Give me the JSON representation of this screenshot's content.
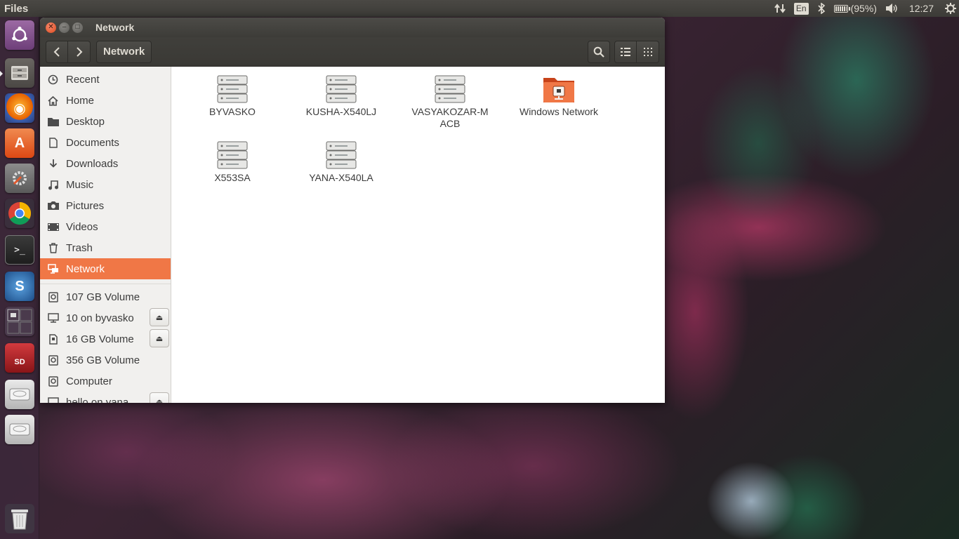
{
  "top_panel": {
    "app_title": "Files",
    "keyboard_layout": "En",
    "battery_percent": "(95%)",
    "battery_level": 0.95,
    "clock": "12:27"
  },
  "launcher": {
    "items": [
      {
        "name": "ubuntu-dash",
        "color": "#7a4b85"
      },
      {
        "name": "files",
        "color": "#5e5a57"
      },
      {
        "name": "firefox",
        "color": "#e66000"
      },
      {
        "name": "software-center",
        "color": "#e0582d"
      },
      {
        "name": "system-settings",
        "color": "#9a9a9a"
      },
      {
        "name": "chrome",
        "color": "#4285f4"
      },
      {
        "name": "terminal",
        "color": "#2d2d2d"
      },
      {
        "name": "app-blue",
        "color": "#2a6fb3"
      },
      {
        "name": "workspace-switcher",
        "color": "#5a4a5e"
      },
      {
        "name": "sd-card",
        "color": "#b3262a"
      },
      {
        "name": "drive-1",
        "color": "#cfcfcf"
      },
      {
        "name": "drive-2",
        "color": "#cfcfcf"
      },
      {
        "name": "trash",
        "color": "#d5d5d5"
      }
    ]
  },
  "window": {
    "title": "Network",
    "path": "Network",
    "sidebar": {
      "places": [
        {
          "label": "Recent",
          "icon": "clock-icon"
        },
        {
          "label": "Home",
          "icon": "home-icon"
        },
        {
          "label": "Desktop",
          "icon": "folder-icon"
        },
        {
          "label": "Documents",
          "icon": "document-icon"
        },
        {
          "label": "Downloads",
          "icon": "download-icon"
        },
        {
          "label": "Music",
          "icon": "music-icon"
        },
        {
          "label": "Pictures",
          "icon": "camera-icon"
        },
        {
          "label": "Videos",
          "icon": "video-icon"
        },
        {
          "label": "Trash",
          "icon": "trash-icon"
        },
        {
          "label": "Network",
          "icon": "network-icon",
          "active": true
        }
      ],
      "devices": [
        {
          "label": "107 GB Volume",
          "icon": "drive-icon",
          "eject": false
        },
        {
          "label": "10 on byvasko",
          "icon": "network-share-icon",
          "eject": true
        },
        {
          "label": "16 GB Volume",
          "icon": "sd-icon",
          "eject": true
        },
        {
          "label": "356 GB Volume",
          "icon": "drive-icon",
          "eject": false
        },
        {
          "label": "Computer",
          "icon": "drive-icon",
          "eject": false
        },
        {
          "label": "hello on yana",
          "icon": "network-share-icon",
          "eject": true
        }
      ]
    },
    "items": [
      {
        "label": "BYVASKO",
        "icon": "server-icon"
      },
      {
        "label": "KUSHA-X540LJ",
        "icon": "server-icon"
      },
      {
        "label": "VASYAKOZAR-MACB",
        "icon": "server-icon"
      },
      {
        "label": "Windows Network",
        "icon": "network-folder-icon"
      },
      {
        "label": "X553SA",
        "icon": "server-icon"
      },
      {
        "label": "YANA-X540LA",
        "icon": "server-icon"
      }
    ]
  },
  "colors": {
    "accent": "#f07746",
    "panel": "#3c3b37",
    "close_button": "#df4a1d"
  }
}
